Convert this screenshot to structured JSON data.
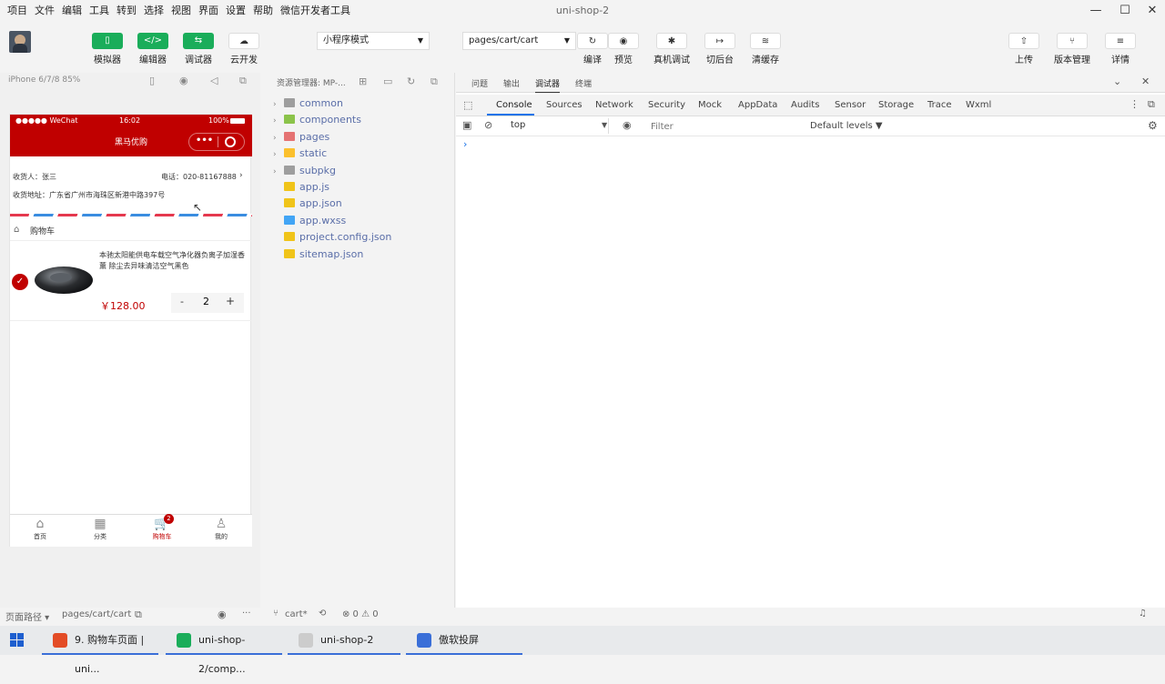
{
  "menubar": {
    "items": [
      "项目",
      "文件",
      "编辑",
      "工具",
      "转到",
      "选择",
      "视图",
      "界面",
      "设置",
      "帮助",
      "微信开发者工具"
    ],
    "title": "uni-shop-2"
  },
  "toolbar": {
    "simulator": "模拟器",
    "editor": "编辑器",
    "debugger": "调试器",
    "cloud": "云开发",
    "mode_select": "小程序模式",
    "page_select": "pages/cart/cart",
    "compile": "编译",
    "preview": "预览",
    "remote_debug": "真机调试",
    "background": "切后台",
    "clear_cache": "清缓存",
    "upload": "上传",
    "version": "版本管理",
    "details": "详情"
  },
  "simulator": {
    "device": "iPhone 6/7/8 85%",
    "status": {
      "carrier": "●●●●● WeChat",
      "time": "16:02",
      "battery": "100%"
    },
    "nav_title": "黑马优购",
    "address": {
      "receiver": "收货人：张三",
      "phone": "电话：020-81167888",
      "addr": "收货地址：广东省广州市海珠区新港中路397号"
    },
    "cart_header": "购物车",
    "item": {
      "name": "本驰太阳能供电车载空气净化器负离子加湿香薰 除尘去异味清洁空气黑色",
      "price": "￥128.00",
      "qty": "2",
      "minus": "-",
      "plus": "+"
    },
    "tabbar": [
      {
        "label": "首页"
      },
      {
        "label": "分类"
      },
      {
        "label": "购物车",
        "badge": "2"
      },
      {
        "label": "我的"
      }
    ],
    "accent": "#c00000"
  },
  "explorer": {
    "title": "资源管理器: MP-...",
    "items": [
      {
        "name": "common",
        "type": "folder",
        "color": "#9e9e9e"
      },
      {
        "name": "components",
        "type": "folder",
        "color": "#8bc34a"
      },
      {
        "name": "pages",
        "type": "folder",
        "color": "#e57373"
      },
      {
        "name": "static",
        "type": "folder",
        "color": "#fbc02d"
      },
      {
        "name": "subpkg",
        "type": "folder",
        "color": "#9e9e9e"
      },
      {
        "name": "app.js",
        "type": "file",
        "color": "#f0c419"
      },
      {
        "name": "app.json",
        "type": "file",
        "color": "#f0c419"
      },
      {
        "name": "app.wxss",
        "type": "file",
        "color": "#42a5f5"
      },
      {
        "name": "project.config.json",
        "type": "file",
        "color": "#f0c419"
      },
      {
        "name": "sitemap.json",
        "type": "file",
        "color": "#f0c419"
      }
    ]
  },
  "devtools": {
    "top_tabs": [
      "问题",
      "输出",
      "调试器",
      "终端"
    ],
    "tabs": [
      "Console",
      "Sources",
      "Network",
      "Security",
      "Mock",
      "AppData",
      "Audits",
      "Sensor",
      "Storage",
      "Trace",
      "Wxml"
    ],
    "context": "top",
    "filter_placeholder": "Filter",
    "levels": "Default levels ▼",
    "prompt": "›"
  },
  "statusbar": {
    "path_label": "页面路径 ▾",
    "path": "pages/cart/cart",
    "branch": "cart*",
    "errors": "⊗ 0 ⚠ 0"
  },
  "taskbar": [
    {
      "label": "9. 购物车页面 | uni...",
      "color": "#e34c26"
    },
    {
      "label": "uni-shop-2/comp...",
      "color": "#1aad5a"
    },
    {
      "label": "uni-shop-2",
      "color": "#cccccc"
    },
    {
      "label": "傲软投屏",
      "color": "#3a6fd8"
    }
  ]
}
